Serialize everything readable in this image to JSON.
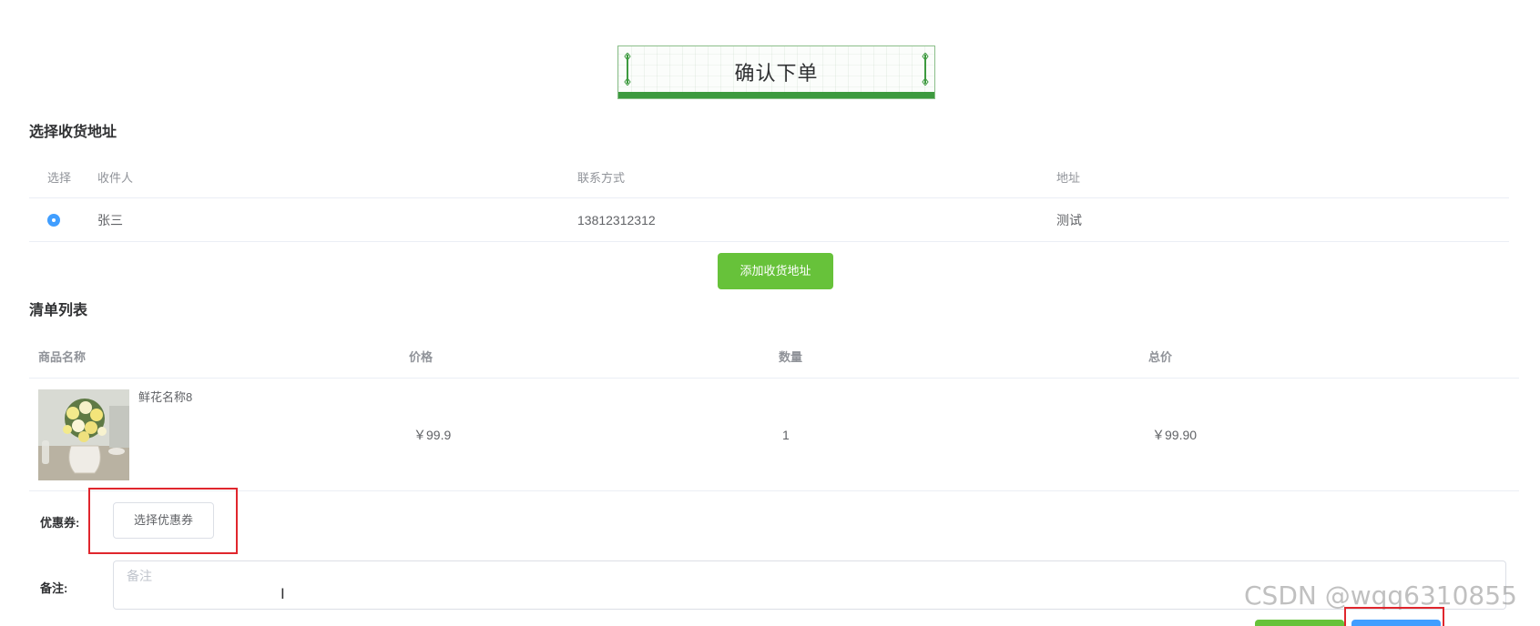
{
  "header": {
    "title": "确认下单"
  },
  "address_section": {
    "title": "选择收货地址",
    "columns": [
      "选择",
      "收件人",
      "联系方式",
      "地址"
    ],
    "rows": [
      {
        "selected": true,
        "name": "张三",
        "phone": "13812312312",
        "address": "测试"
      }
    ],
    "add_button": "添加收货地址"
  },
  "list_section": {
    "title": "清单列表",
    "columns": [
      "商品名称",
      "价格",
      "数量",
      "总价"
    ],
    "items": [
      {
        "name": "鲜花名称8",
        "price": "￥99.9",
        "quantity": "1",
        "total": "￥99.90",
        "image_icon": "flower-vase-image"
      }
    ]
  },
  "coupon": {
    "label": "优惠券:",
    "button": "选择优惠券"
  },
  "remark": {
    "label": "备注:",
    "placeholder": "备注",
    "value": ""
  },
  "watermark": "CSDN @wqq6310855",
  "colors": {
    "accent_green": "#67c23a",
    "accent_blue": "#409eff",
    "highlight_red": "#e0262d",
    "title_green": "#3d9a3f"
  }
}
